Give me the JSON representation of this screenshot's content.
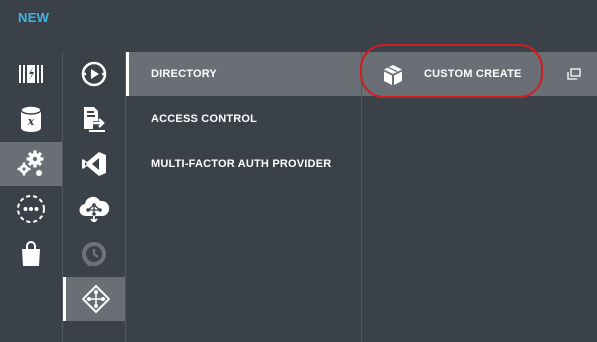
{
  "header": {
    "title": "NEW"
  },
  "left_rail": [
    {
      "icon": "web-sites-icon"
    },
    {
      "icon": "sql-database-icon"
    },
    {
      "icon": "app-services-icon",
      "selected": true
    },
    {
      "icon": "more-services-icon"
    },
    {
      "icon": "store-bag-icon"
    }
  ],
  "service_rail": [
    {
      "icon": "media-services-icon"
    },
    {
      "icon": "biztalk-services-icon"
    },
    {
      "icon": "visual-studio-online-icon"
    },
    {
      "icon": "cloud-network-icon"
    },
    {
      "icon": "scheduler-icon"
    },
    {
      "icon": "active-directory-icon",
      "selected": true
    }
  ],
  "menu": {
    "items": [
      "DIRECTORY",
      "ACCESS CONTROL",
      "MULTI-FACTOR AUTH PROVIDER"
    ],
    "selected": "DIRECTORY"
  },
  "actions": {
    "custom_create_label": "CUSTOM CREATE",
    "custom_create_icon": "package-box-icon",
    "open_icon": "open-window-icon"
  },
  "colors": {
    "background": "#3b4148",
    "selected": "#6a6f75",
    "accent": "#3fb4e5",
    "highlight": "#cc1f1f"
  }
}
